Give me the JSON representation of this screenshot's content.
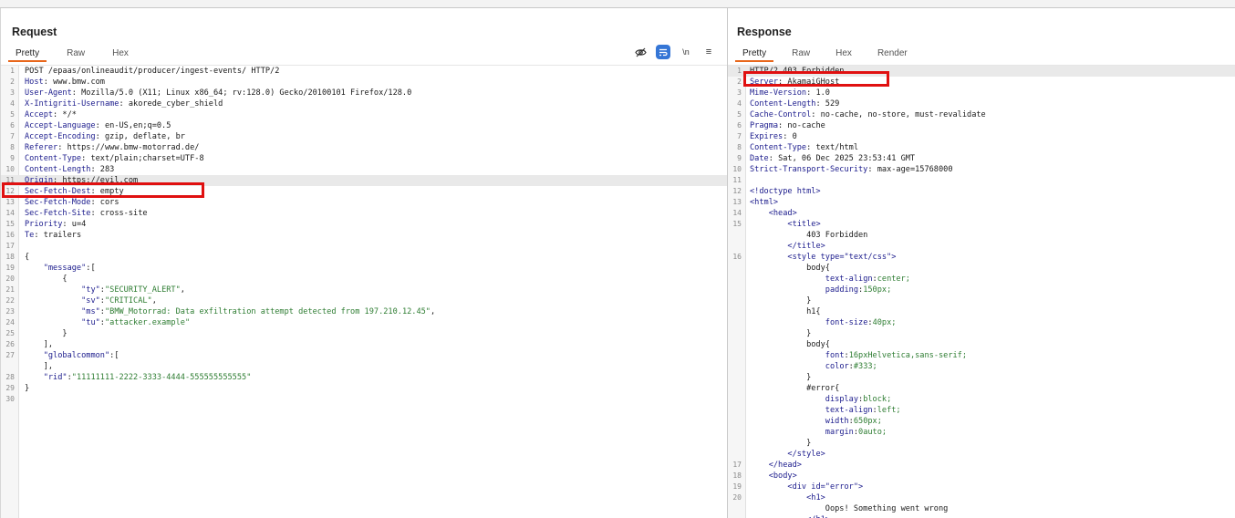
{
  "request": {
    "title": "Request",
    "tabs": [
      {
        "label": "Pretty",
        "active": true
      },
      {
        "label": "Raw",
        "active": false
      },
      {
        "label": "Hex",
        "active": false
      }
    ],
    "tools": [
      {
        "icon": "eye-slash-icon"
      },
      {
        "icon": "wrap-lines-icon",
        "active": true
      },
      {
        "label": "\\n"
      },
      {
        "icon": "menu-icon",
        "label": "≡"
      }
    ],
    "lines": [
      {
        "n": "1",
        "text": "POST /epaas/onlineaudit/producer/ingest-events/ HTTP/2"
      },
      {
        "n": "2",
        "key": "Host",
        "value": " www.bmw.com"
      },
      {
        "n": "3",
        "key": "User-Agent",
        "value": " Mozilla/5.0 (X11; Linux x86_64; rv:128.0) Gecko/20100101 Firefox/128.0"
      },
      {
        "n": "4",
        "key": "X-Intigriti-Username",
        "value": " akorede_cyber_shield"
      },
      {
        "n": "5",
        "key": "Accept",
        "value": " */*"
      },
      {
        "n": "6",
        "key": "Accept-Language",
        "value": " en-US,en;q=0.5"
      },
      {
        "n": "7",
        "key": "Accept-Encoding",
        "value": " gzip, deflate, br"
      },
      {
        "n": "8",
        "key": "Referer",
        "value": " https://www.bmw-motorrad.de/"
      },
      {
        "n": "9",
        "key": "Content-Type",
        "value": " text/plain;charset=UTF-8"
      },
      {
        "n": "10",
        "key": "Content-Length",
        "value": " 283"
      },
      {
        "n": "11",
        "key": "Origin",
        "value": " https://evil.com"
      },
      {
        "n": "12",
        "key": "Sec-Fetch-Dest",
        "value": " empty"
      },
      {
        "n": "13",
        "key": "Sec-Fetch-Mode",
        "value": " cors"
      },
      {
        "n": "14",
        "key": "Sec-Fetch-Site",
        "value": " cross-site"
      },
      {
        "n": "15",
        "key": "Priority",
        "value": " u=4"
      },
      {
        "n": "16",
        "key": "Te",
        "value": " trailers"
      },
      {
        "n": "17",
        "text": ""
      },
      {
        "n": "18",
        "text": "{"
      },
      {
        "n": "19",
        "indent": "    ",
        "str": "\"message\"",
        "rest": ":["
      },
      {
        "n": "20",
        "text": "        {"
      },
      {
        "n": "21",
        "indent": "            ",
        "str": "\"ty\"",
        "rest": ":",
        "sval": "\"SECURITY_ALERT\"",
        "tail": ","
      },
      {
        "n": "22",
        "indent": "            ",
        "str": "\"sv\"",
        "rest": ":",
        "sval": "\"CRITICAL\"",
        "tail": ","
      },
      {
        "n": "23",
        "indent": "            ",
        "str": "\"ms\"",
        "rest": ":",
        "sval": "\"BMW_Motorrad: Data exfiltration attempt detected from 197.210.12.45\"",
        "tail": ","
      },
      {
        "n": "24",
        "indent": "            ",
        "str": "\"tu\"",
        "rest": ":",
        "sval": "\"attacker.example\"",
        "tail": ""
      },
      {
        "n": "25",
        "text": "        }"
      },
      {
        "n": "26",
        "text": "    ],"
      },
      {
        "n": "27",
        "indent": "    ",
        "str": "\"globalcommon\"",
        "rest": ":["
      },
      {
        "n": "",
        "text": "    ],"
      },
      {
        "n": "28",
        "indent": "    ",
        "str": "\"rid\"",
        "rest": ":",
        "sval": "\"11111111-2222-3333-4444-555555555555\"",
        "tail": ""
      },
      {
        "n": "29",
        "text": "}"
      },
      {
        "n": "30",
        "text": ""
      }
    ]
  },
  "response": {
    "title": "Response",
    "tabs": [
      {
        "label": "Pretty",
        "active": true
      },
      {
        "label": "Raw",
        "active": false
      },
      {
        "label": "Hex",
        "active": false
      },
      {
        "label": "Render",
        "active": false
      }
    ],
    "lines": [
      {
        "n": "1",
        "text": "HTTP/2 403 Forbidden"
      },
      {
        "n": "2",
        "key": "Server",
        "value": " AkamaiGHost"
      },
      {
        "n": "3",
        "key": "Mime-Version",
        "value": " 1.0"
      },
      {
        "n": "4",
        "key": "Content-Length",
        "value": " 529"
      },
      {
        "n": "5",
        "key": "Cache-Control",
        "value": " no-cache, no-store, must-revalidate"
      },
      {
        "n": "6",
        "key": "Pragma",
        "value": " no-cache"
      },
      {
        "n": "7",
        "key": "Expires",
        "value": " 0"
      },
      {
        "n": "8",
        "key": "Content-Type",
        "value": " text/html"
      },
      {
        "n": "9",
        "key": "Date",
        "value": " Sat, 06 Dec 2025 23:53:41 GMT"
      },
      {
        "n": "10",
        "key": "Strict-Transport-Security",
        "value": " max-age=15768000"
      },
      {
        "n": "11",
        "text": ""
      },
      {
        "n": "12",
        "html": "<!doctype html>"
      },
      {
        "n": "13",
        "html": "<html>"
      },
      {
        "n": "14",
        "indent": "    ",
        "html": "<head>"
      },
      {
        "n": "15",
        "indent": "        ",
        "html": "<title>"
      },
      {
        "n": "",
        "text": "            403 Forbidden"
      },
      {
        "n": "",
        "indent": "        ",
        "html": "</title>"
      },
      {
        "n": "16",
        "indent": "        ",
        "html": "<style type=\"text/css\">"
      },
      {
        "n": "",
        "text": "            body{"
      },
      {
        "n": "",
        "indent": "                ",
        "prop": "text-align",
        "pval": "center;"
      },
      {
        "n": "",
        "indent": "                ",
        "prop": "padding",
        "pval": "150px;"
      },
      {
        "n": "",
        "text": "            }"
      },
      {
        "n": "",
        "text": "            h1{"
      },
      {
        "n": "",
        "indent": "                ",
        "prop": "font-size",
        "pval": "40px;"
      },
      {
        "n": "",
        "text": "            }"
      },
      {
        "n": "",
        "text": "            body{"
      },
      {
        "n": "",
        "indent": "                ",
        "prop": "font",
        "pval": "16pxHelvetica,sans-serif;"
      },
      {
        "n": "",
        "indent": "                ",
        "prop": "color",
        "pval": "#333;"
      },
      {
        "n": "",
        "text": "            }"
      },
      {
        "n": "",
        "text": "            #error{"
      },
      {
        "n": "",
        "indent": "                ",
        "prop": "display",
        "pval": "block;"
      },
      {
        "n": "",
        "indent": "                ",
        "prop": "text-align",
        "pval": "left;"
      },
      {
        "n": "",
        "indent": "                ",
        "prop": "width",
        "pval": "650px;"
      },
      {
        "n": "",
        "indent": "                ",
        "prop": "margin",
        "pval": "0auto;"
      },
      {
        "n": "",
        "text": "            }"
      },
      {
        "n": "",
        "indent": "        ",
        "html": "</style>"
      },
      {
        "n": "17",
        "indent": "    ",
        "html": "</head>"
      },
      {
        "n": "18",
        "indent": "    ",
        "html": "<body>"
      },
      {
        "n": "19",
        "indent": "        ",
        "html": "<div id=\"error\">"
      },
      {
        "n": "20",
        "indent": "            ",
        "html": "<h1>"
      },
      {
        "n": "",
        "text": "                Oops! Something went wrong"
      },
      {
        "n": "",
        "indent": "            ",
        "html": "</h1>"
      }
    ]
  },
  "colors": {
    "accent_tab": "#e8671b",
    "highlight_box": "#e01010",
    "active_tool": "#3576d6"
  }
}
